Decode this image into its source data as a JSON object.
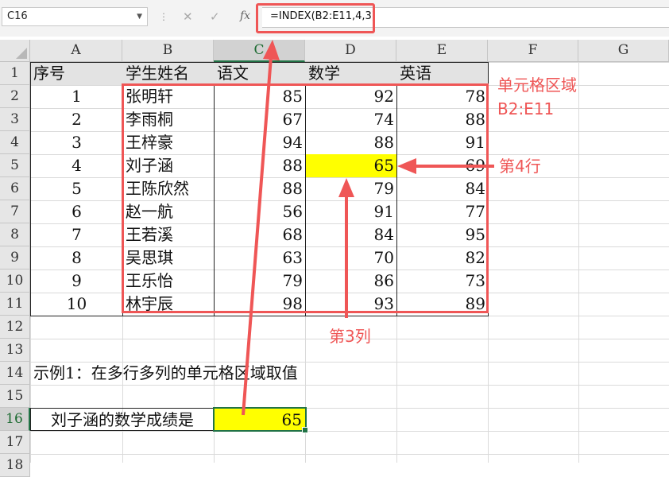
{
  "formula_bar": {
    "name_box": "C16",
    "cancel_icon": "✕",
    "enter_icon": "✓",
    "fx_label": "fx",
    "formula": "=INDEX(B2:E11,4,3)"
  },
  "columns": [
    "A",
    "B",
    "C",
    "D",
    "E",
    "F",
    "G"
  ],
  "rows": [
    "1",
    "2",
    "3",
    "4",
    "5",
    "6",
    "7",
    "8",
    "9",
    "10",
    "11",
    "12",
    "13",
    "14",
    "15",
    "16",
    "17",
    "18"
  ],
  "table": {
    "headers": [
      "序号",
      "学生姓名",
      "语文",
      "数学",
      "英语"
    ],
    "records": [
      {
        "id": "1",
        "name": "张明轩",
        "chinese": "85",
        "math": "92",
        "english": "78"
      },
      {
        "id": "2",
        "name": "李雨桐",
        "chinese": "67",
        "math": "74",
        "english": "88"
      },
      {
        "id": "3",
        "name": "王梓豪",
        "chinese": "94",
        "math": "88",
        "english": "91"
      },
      {
        "id": "4",
        "name": "刘子涵",
        "chinese": "88",
        "math": "65",
        "english": "69"
      },
      {
        "id": "5",
        "name": "王陈欣然",
        "chinese": "88",
        "math": "79",
        "english": "84"
      },
      {
        "id": "6",
        "name": "赵一航",
        "chinese": "56",
        "math": "91",
        "english": "77"
      },
      {
        "id": "7",
        "name": "王若溪",
        "chinese": "68",
        "math": "84",
        "english": "95"
      },
      {
        "id": "8",
        "name": "吴思琪",
        "chinese": "63",
        "math": "70",
        "english": "82"
      },
      {
        "id": "9",
        "name": "王乐怡",
        "chinese": "79",
        "math": "86",
        "english": "73"
      },
      {
        "id": "10",
        "name": "林宇辰",
        "chinese": "98",
        "math": "93",
        "english": "89"
      }
    ]
  },
  "example": {
    "title": "示例1：在多行多列的单元格区域取值",
    "label": "刘子涵的数学成绩是",
    "result": "65"
  },
  "annotations": {
    "range_line1": "单元格区域",
    "range_line2": "B2:E11",
    "row_label": "第4行",
    "col_label": "第3列"
  },
  "colors": {
    "annotation_red": "#ef5656",
    "highlight_yellow": "#ffff00",
    "selection_green": "#217346"
  }
}
